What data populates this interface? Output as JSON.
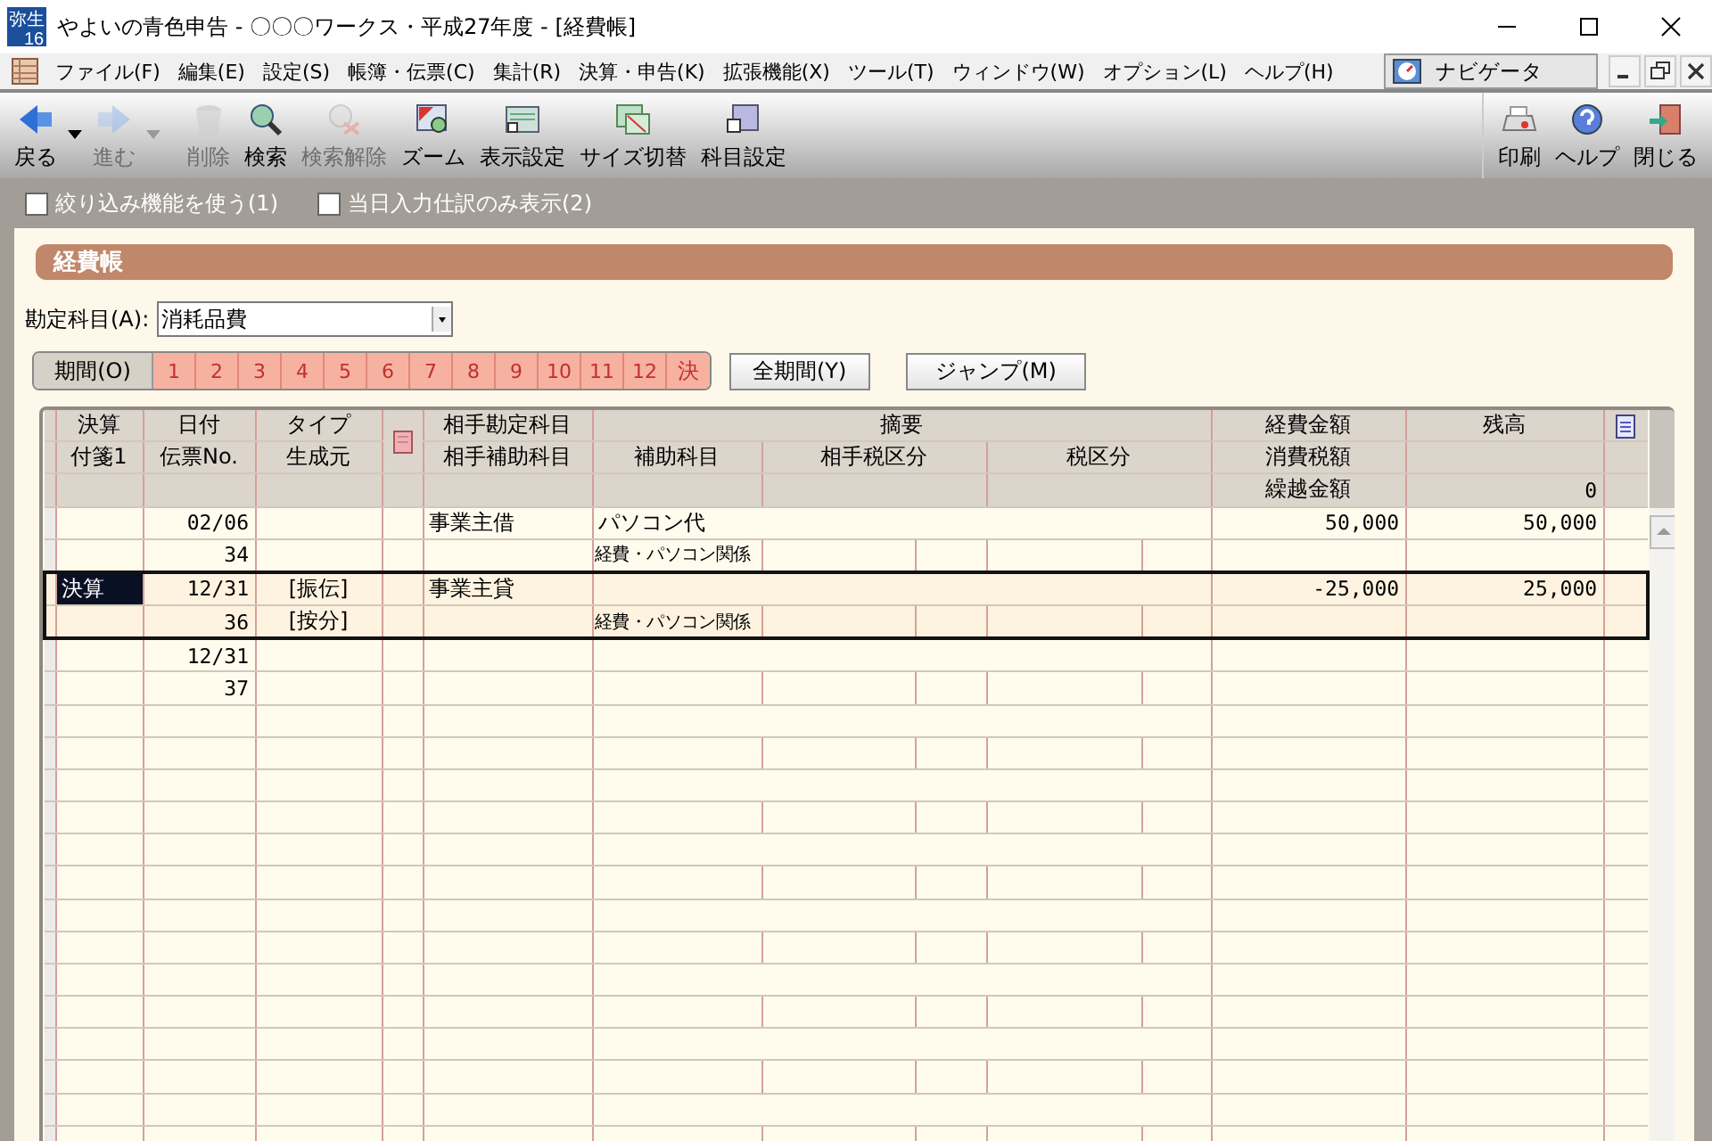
{
  "window": {
    "logo": [
      "弥生",
      "16"
    ],
    "title": "やよいの青色申告 - 〇〇〇ワークス・平成27年度 - [経費帳]"
  },
  "menu": [
    "ファイル(F)",
    "編集(E)",
    "設定(S)",
    "帳簿・伝票(C)",
    "集計(R)",
    "決算・申告(K)",
    "拡張機能(X)",
    "ツール(T)",
    "ウィンドウ(W)",
    "オプション(L)",
    "ヘルプ(H)"
  ],
  "navigator": "ナビゲータ",
  "toolbar": [
    {
      "kind": "back",
      "label": "戻る",
      "disabled": false,
      "dropdown": true
    },
    {
      "kind": "forward",
      "label": "進む",
      "disabled": true,
      "dropdown": true
    },
    {
      "kind": "delete",
      "label": "削除",
      "disabled": true,
      "dropdown": false
    },
    {
      "kind": "search",
      "label": "検索",
      "disabled": false,
      "dropdown": false
    },
    {
      "kind": "clear",
      "label": "検索解除",
      "disabled": true,
      "dropdown": false
    },
    {
      "kind": "zoom",
      "label": "ズーム",
      "disabled": false,
      "dropdown": false
    },
    {
      "kind": "display",
      "label": "表示設定",
      "disabled": false,
      "dropdown": false
    },
    {
      "kind": "resize",
      "label": "サイズ切替",
      "disabled": false,
      "dropdown": false
    },
    {
      "kind": "accounts",
      "label": "科目設定",
      "disabled": false,
      "dropdown": false
    }
  ],
  "toolbar_right": [
    {
      "kind": "print",
      "label": "印刷",
      "disabled": false
    },
    {
      "kind": "help",
      "label": "ヘルプ",
      "disabled": false
    },
    {
      "kind": "exit",
      "label": "閉じる",
      "disabled": false
    }
  ],
  "filters": [
    {
      "label": "絞り込み機能を使う(1)",
      "checked": false
    },
    {
      "label": "当日入力仕訳のみ表示(2)",
      "checked": false
    }
  ],
  "panel_title": "経費帳",
  "account": {
    "label": "勘定科目(A):",
    "value": "消耗品費"
  },
  "period": {
    "label": "期間(O)",
    "months": [
      "1",
      "2",
      "3",
      "4",
      "5",
      "6",
      "7",
      "8",
      "9",
      "10",
      "11",
      "12",
      "決"
    ]
  },
  "buttons": [
    "全期間(Y)",
    "ジャンプ(M)"
  ],
  "table": {
    "header": {
      "tag": "決算",
      "tag2": "付箋1",
      "date": "日付",
      "slip": "伝票No.",
      "type": "タイプ",
      "source": "生成元",
      "counter": "相手勘定科目",
      "counter_sub": "相手補助科目",
      "summary": "摘要",
      "sub": "補助科目",
      "counter_tax": "相手税区分",
      "tax": "税区分",
      "amount": "経費金額",
      "tax_amount": "消費税額",
      "carry_label": "繰越金額",
      "balance": "残高",
      "carry": "0"
    },
    "rows": [
      {
        "selected": false,
        "date": "02/06",
        "slip": "34",
        "counter": "事業主借",
        "summary": "パソコン代",
        "sub": "経費・パソコン関係",
        "amount": "50,000",
        "balance": "50,000"
      },
      {
        "selected": true,
        "tag": "決算",
        "date": "12/31",
        "slip": "36",
        "type": "[振伝]",
        "source": "[按分]",
        "counter": "事業主貸",
        "sub": "経費・パソコン関係",
        "amount": "-25,000",
        "balance": "25,000"
      },
      {
        "selected": false,
        "date": "12/31",
        "slip": "37"
      }
    ]
  }
}
